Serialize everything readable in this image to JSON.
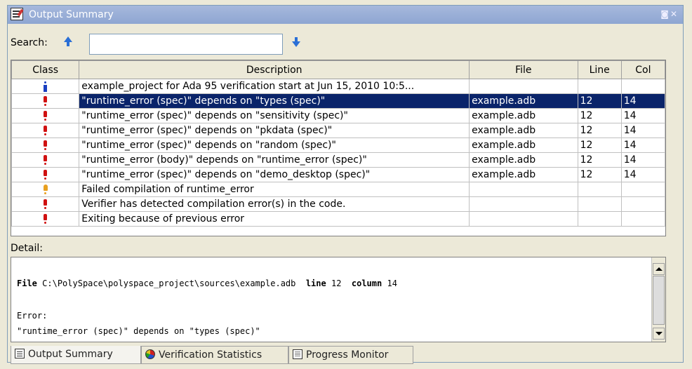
{
  "window": {
    "title": "Output Summary",
    "title_buttons": "◙✕"
  },
  "search": {
    "label": "Search:",
    "value": ""
  },
  "table": {
    "columns": [
      "Class",
      "Description",
      "File",
      "Line",
      "Col"
    ],
    "rows": [
      {
        "class_icon": "info-icon",
        "description": "example_project for Ada 95 verification start at Jun 15, 2010 10:5...",
        "file": "",
        "line": "",
        "col": ""
      },
      {
        "class_icon": "error-icon",
        "description": "\"runtime_error (spec)\" depends on \"types (spec)\"",
        "file": "example.adb",
        "line": "12",
        "col": "14"
      },
      {
        "class_icon": "error-icon",
        "description": "\"runtime_error (spec)\" depends on \"sensitivity (spec)\"",
        "file": "example.adb",
        "line": "12",
        "col": "14"
      },
      {
        "class_icon": "error-icon",
        "description": "\"runtime_error (spec)\" depends on \"pkdata (spec)\"",
        "file": "example.adb",
        "line": "12",
        "col": "14"
      },
      {
        "class_icon": "error-icon",
        "description": "\"runtime_error (spec)\" depends on \"random (spec)\"",
        "file": "example.adb",
        "line": "12",
        "col": "14"
      },
      {
        "class_icon": "error-icon",
        "description": "\"runtime_error (body)\" depends on \"runtime_error (spec)\"",
        "file": "example.adb",
        "line": "12",
        "col": "14"
      },
      {
        "class_icon": "error-icon",
        "description": "\"runtime_error (spec)\" depends on \"demo_desktop (spec)\"",
        "file": "example.adb",
        "line": "12",
        "col": "14"
      },
      {
        "class_icon": "warning-icon",
        "description": "Failed compilation of runtime_error",
        "file": "",
        "line": "",
        "col": ""
      },
      {
        "class_icon": "error-icon",
        "description": "Verifier has detected compilation error(s) in the code.",
        "file": "",
        "line": "",
        "col": ""
      },
      {
        "class_icon": "error-icon",
        "description": "Exiting because of previous error",
        "file": "",
        "line": "",
        "col": ""
      }
    ],
    "selected_row": 1
  },
  "detail": {
    "label": "Detail:",
    "file_keyword": "File",
    "file_path": "C:\\PolySpace\\polyspace_project\\sources\\example.adb",
    "line_keyword": "line",
    "line_value": "12",
    "column_keyword": "column",
    "column_value": "14",
    "error_label": "Error:",
    "error_message": "\"runtime_error (spec)\" depends on \"types (spec)\""
  },
  "tabs": [
    {
      "label": "Output Summary",
      "icon": "summary-icon",
      "active": true
    },
    {
      "label": "Verification Statistics",
      "icon": "pie-chart-icon",
      "active": false
    },
    {
      "label": "Progress Monitor",
      "icon": "monitor-icon",
      "active": false
    }
  ],
  "colors": {
    "selection": "#0a246a",
    "error": "#d01010",
    "warning": "#e8a020",
    "info": "#1a3fc0",
    "title_bar": "#8ea6d2"
  }
}
